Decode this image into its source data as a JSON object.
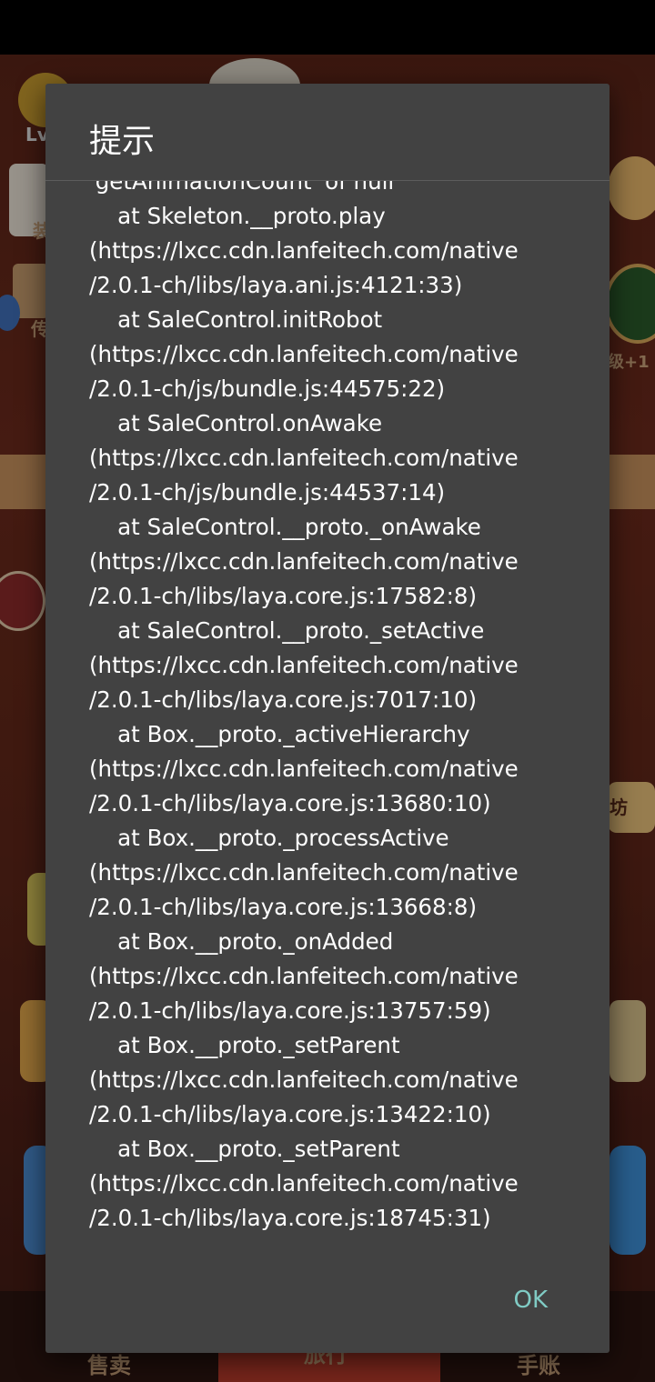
{
  "dialog": {
    "title": "提示",
    "message": "'getAnimationCount' of null\n    at Skeleton.__proto.play\n(https://lxcc.cdn.lanfeitech.com/native\n/2.0.1-ch/libs/laya.ani.js:4121:33)\n    at SaleControl.initRobot\n(https://lxcc.cdn.lanfeitech.com/native\n/2.0.1-ch/js/bundle.js:44575:22)\n    at SaleControl.onAwake\n(https://lxcc.cdn.lanfeitech.com/native\n/2.0.1-ch/js/bundle.js:44537:14)\n    at SaleControl.__proto._onAwake\n(https://lxcc.cdn.lanfeitech.com/native\n/2.0.1-ch/libs/laya.core.js:17582:8)\n    at SaleControl.__proto._setActive\n(https://lxcc.cdn.lanfeitech.com/native\n/2.0.1-ch/libs/laya.core.js:7017:10)\n    at Box.__proto._activeHierarchy\n(https://lxcc.cdn.lanfeitech.com/native\n/2.0.1-ch/libs/laya.core.js:13680:10)\n    at Box.__proto._processActive\n(https://lxcc.cdn.lanfeitech.com/native\n/2.0.1-ch/libs/laya.core.js:13668:8)\n    at Box.__proto._onAdded\n(https://lxcc.cdn.lanfeitech.com/native\n/2.0.1-ch/libs/laya.core.js:13757:59)\n    at Box.__proto._setParent\n(https://lxcc.cdn.lanfeitech.com/native\n/2.0.1-ch/libs/laya.core.js:13422:10)\n    at Box.__proto._setParent\n(https://lxcc.cdn.lanfeitech.com/native\n/2.0.1-ch/libs/laya.core.js:18745:31)",
    "ok_label": "OK"
  },
  "background": {
    "level_label": "Lv",
    "left_labels": [
      "装",
      "传"
    ],
    "right_labels": [
      "级+1",
      "坊"
    ],
    "bottom_tabs": [
      "售卖",
      "旅行",
      "手账"
    ]
  },
  "colors": {
    "dialog_bg": "#424242",
    "accent": "#80cbc4",
    "text": "#ffffff"
  }
}
